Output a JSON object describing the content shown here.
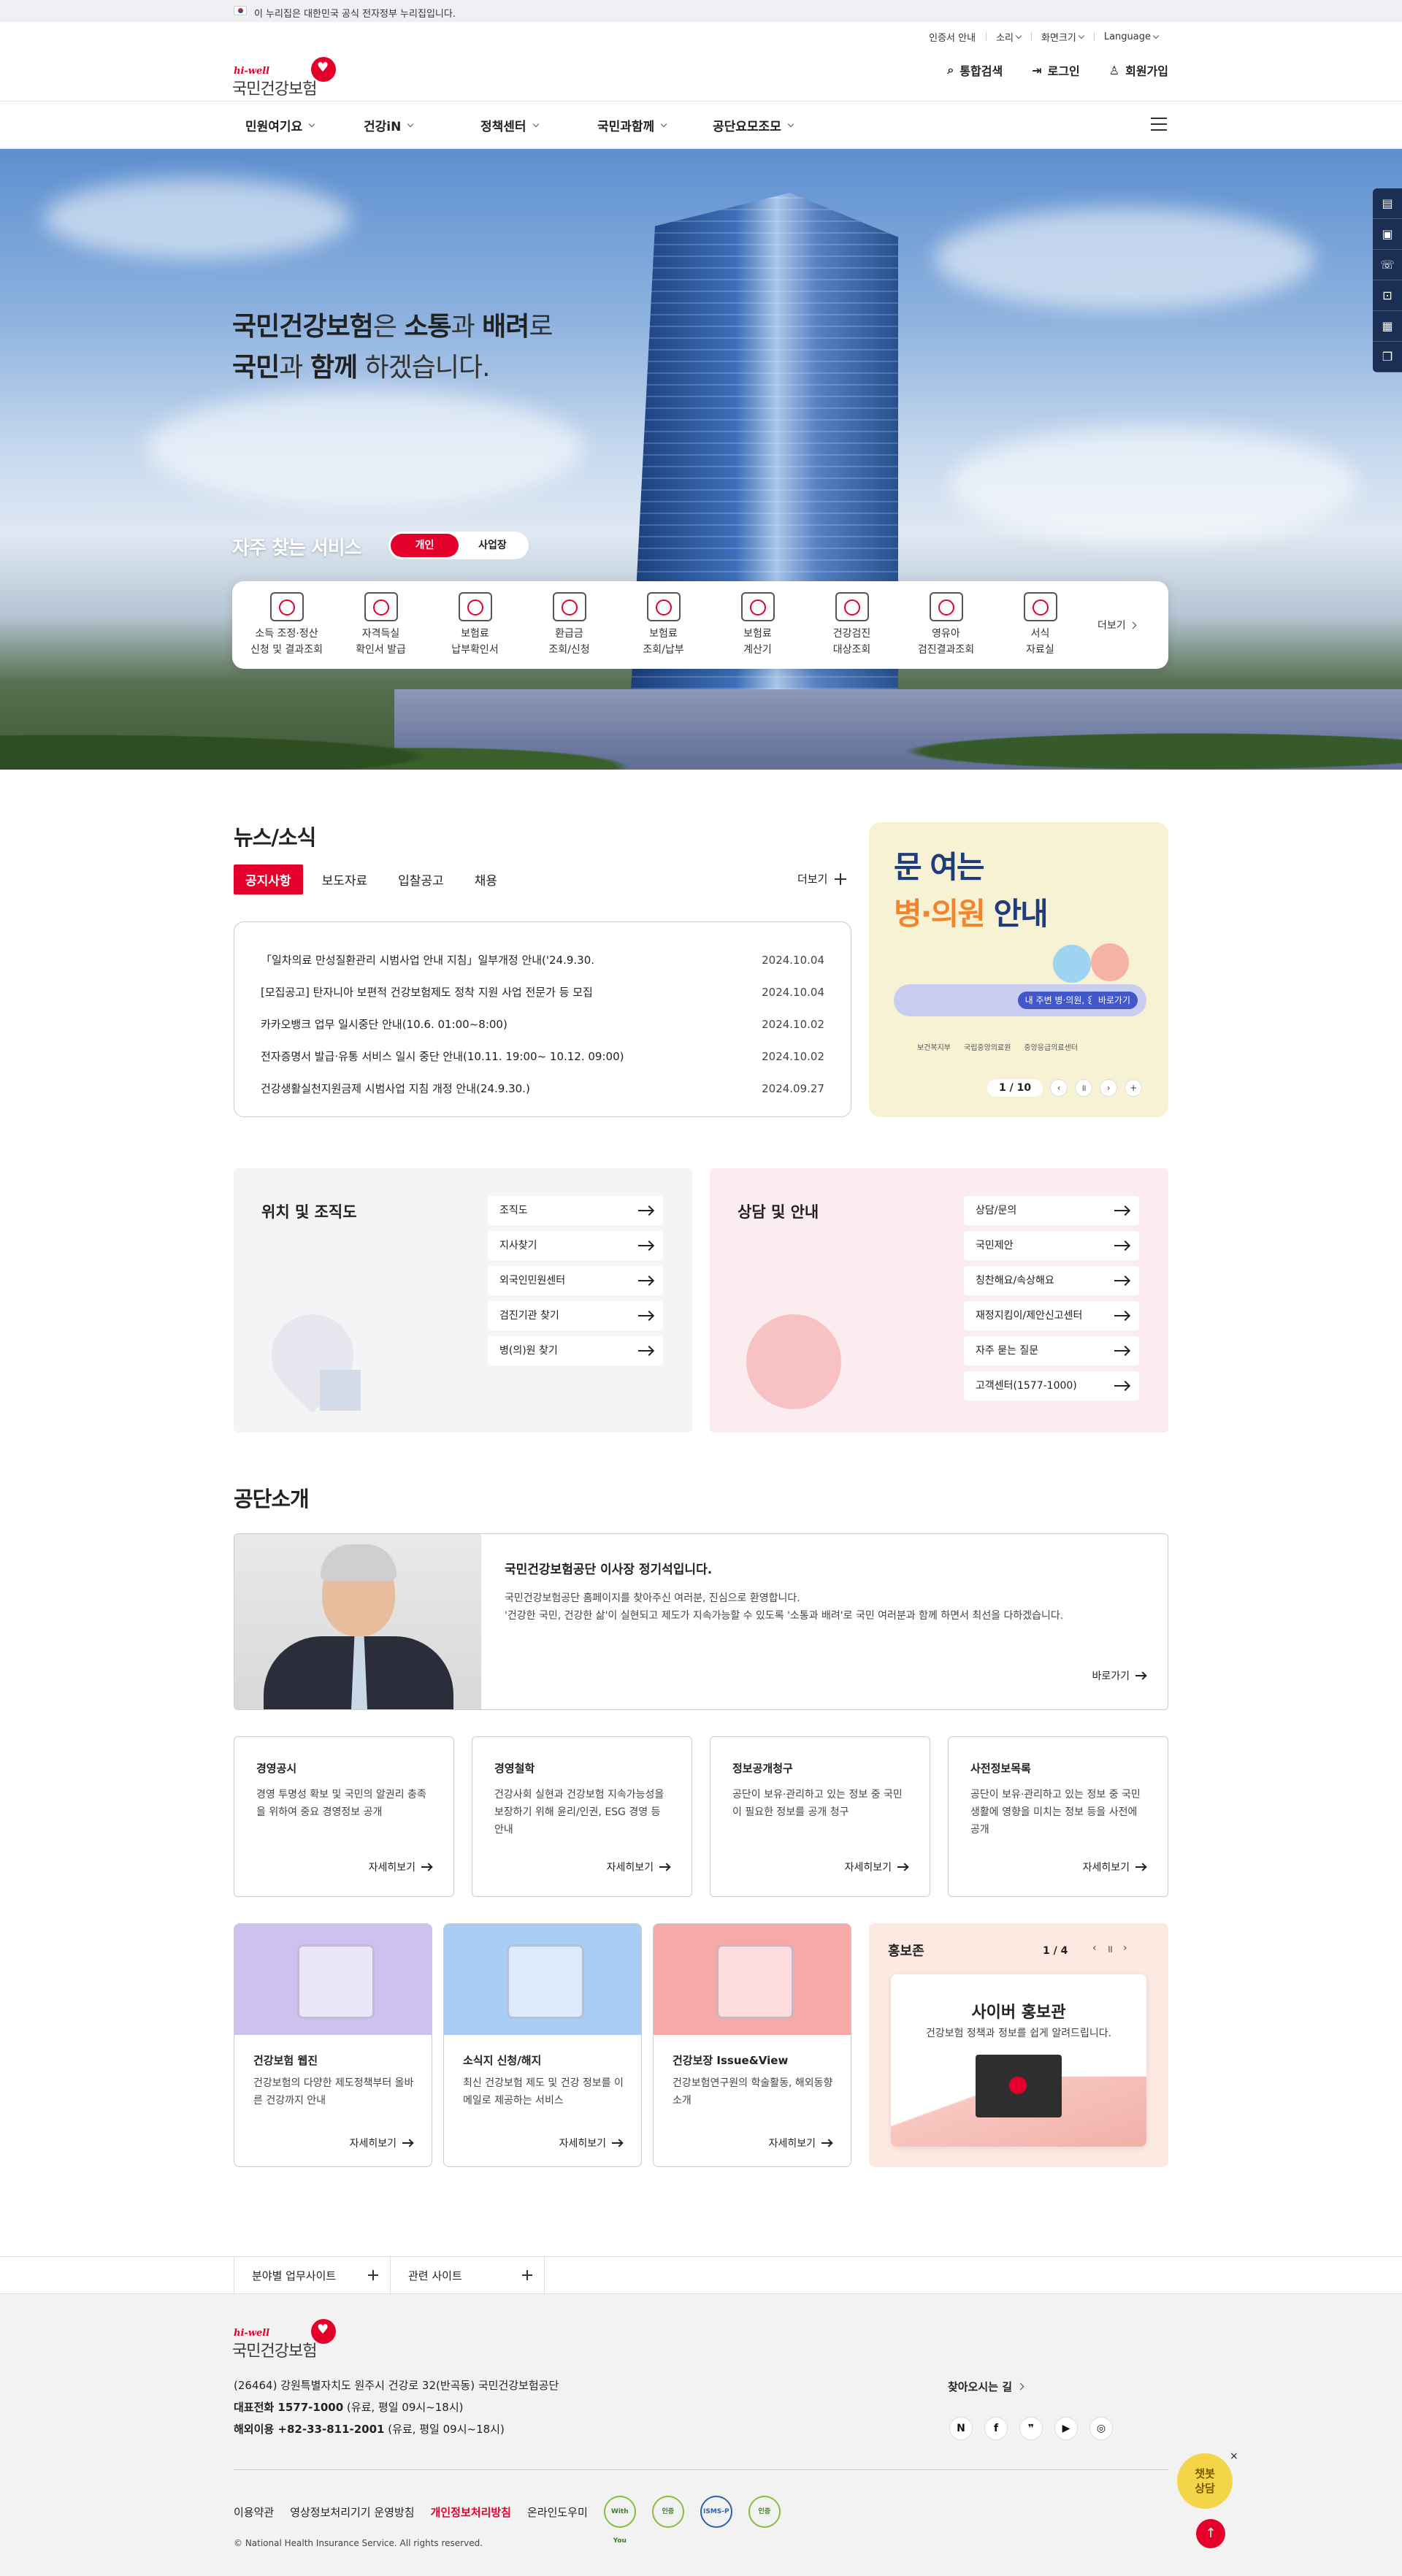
{
  "gov_banner": {
    "text": "이 누리집은 대한민국 공식 전자정부 누리집입니다."
  },
  "utility": {
    "cert": "인증서 안내",
    "sound": "소리",
    "zoom": "화면크기",
    "language": "Language"
  },
  "logo": {
    "small": "hi-well",
    "name": "국민건강보험"
  },
  "header": {
    "search": "통합검색",
    "login": "로그인",
    "signup": "회원가입"
  },
  "gnb": [
    "민원여기요",
    "건강iN",
    "정책센터",
    "국민과함께",
    "공단요모조모"
  ],
  "hero": {
    "slogan_line1": [
      "국민건강보험",
      "은 ",
      "소통",
      "과 ",
      "배려",
      "로"
    ],
    "slogan_line2": [
      "국민",
      "과 ",
      "함께",
      " 하겠습니다."
    ],
    "freq_title": "자주 찾는 서비스",
    "toggle": [
      "개인",
      "사업장"
    ],
    "services": [
      [
        "소득 조정·정산",
        "신청 및 결과조회"
      ],
      [
        "자격득실",
        "확인서 발급"
      ],
      [
        "보험료",
        "납부확인서"
      ],
      [
        "환급금",
        "조회/신청"
      ],
      [
        "보험료",
        "조회/납부"
      ],
      [
        "보험료",
        "계산기"
      ],
      [
        "건강검진",
        "대상조회"
      ],
      [
        "영유아",
        "검진결과조회"
      ],
      [
        "서식",
        "자료실"
      ]
    ],
    "more": "더보기"
  },
  "news": {
    "title": "뉴스/소식",
    "tabs": [
      "공지사항",
      "보도자료",
      "입찰공고",
      "채용"
    ],
    "more": "더보기",
    "items": [
      {
        "title": "「일차의료 만성질환관리 시범사업 안내 지침」일부개정 안내('24.9.30.",
        "date": "2024.10.04"
      },
      {
        "title": "[모집공고] 탄자니아 보편적 건강보험제도 정착 지원 사업 전문가 등 모집",
        "date": "2024.10.04"
      },
      {
        "title": "카카오뱅크 업무 일시중단 안내(10.6. 01:00~8:00)",
        "date": "2024.10.02"
      },
      {
        "title": "전자증명서 발급·유통 서비스 일시 중단 안내(10.11. 19:00~ 10.12. 09:00)",
        "date": "2024.10.02"
      },
      {
        "title": "건강생활실천지원금제 시범사업 지침 개정 안내(24.9.30.)",
        "date": "2024.09.27"
      }
    ]
  },
  "banner": {
    "line1": "문 여는",
    "line2a": "병·의원",
    "line2b": " 안내",
    "pill": "내 주변 병·의원, 응급실 찾기",
    "pill_btn": "바로가기",
    "logos": [
      "보건복지부",
      "국립중앙의료원",
      "중앙응급의료센터"
    ],
    "page": "1 / 10"
  },
  "location": {
    "title": "위치 및 조직도",
    "links": [
      "조직도",
      "지사찾기",
      "외국인민원센터",
      "검진기관 찾기",
      "병(의)원 찾기"
    ]
  },
  "consult": {
    "title": "상담 및 안내",
    "links": [
      "상담/문의",
      "국민제안",
      "칭찬해요/속상해요",
      "재정지킴이/제안신고센터",
      "자주 묻는 질문",
      "고객센터(1577-1000)"
    ]
  },
  "intro": {
    "title": "공단소개",
    "ceo_title": "국민건강보험공단 이사장 정기석입니다.",
    "ceo_text1": "국민건강보험공단 홈페이지를 찾아주신 여러분, 진심으로 환영합니다.",
    "ceo_text2": "'건강한 국민, 건강한 삶'이 실현되고 제도가 지속가능할 수 있도록 '소통과 배려'로 국민 여러분과 함께 하면서 최선을 다하겠습니다.",
    "go": "바로가기",
    "cards": [
      {
        "title": "경영공시",
        "text": "경영 투명성 확보 및 국민의 알권리 충족을 위하여 중요 경영정보 공개",
        "go": "자세히보기"
      },
      {
        "title": "경영철학",
        "text": "건강사회 실현과 건강보험 지속가능성을 보장하기 위해 윤리/인권, ESG 경영 등 안내",
        "go": "자세히보기"
      },
      {
        "title": "정보공개청구",
        "text": "공단이 보유·관리하고 있는 정보 중 국민이 필요한 정보를 공개 청구",
        "go": "자세히보기"
      },
      {
        "title": "사전정보목록",
        "text": "공단이 보유·관리하고 있는 정보 중 국민생활에 영향을 미치는 정보 등을 사전에 공개",
        "go": "자세히보기"
      }
    ],
    "pcards": [
      {
        "title": "건강보험 웹진",
        "text": "건강보험의 다양한 제도정책부터 올바른 건강까지 안내",
        "go": "자세히보기"
      },
      {
        "title": "소식지 신청/해지",
        "text": "최신 건강보험 제도 및 건강 정보를 이메일로 제공하는 서비스",
        "go": "자세히보기"
      },
      {
        "title": "건강보장 Issue&View",
        "text": "건강보험연구원의 학술활동, 해외동향 소개",
        "go": "자세히보기"
      }
    ],
    "promo": {
      "title": "홍보존",
      "page": "1 / 4",
      "inner_title": "사이버 홍보관",
      "inner_sub": "건강보험 정책과 정보를 쉽게 알려드립니다."
    }
  },
  "family": [
    "분야별 업무사이트",
    "관련 사이트"
  ],
  "footer": {
    "address": "(26464) 강원특별자치도 원주시 건강로 32(반곡동) 국민건강보험공단",
    "phone_label": "대표전화 1577-1000",
    "phone_note": " (유료, 평일 09시~18시)",
    "abroad_label": "해외이용 +82-33-811-2001",
    "abroad_note": " (유료, 평일 09시~18시)",
    "directions": "찾아오시는 길",
    "sns": [
      "N",
      "f",
      "❞",
      "▶",
      "◎"
    ],
    "links": [
      "이용약관",
      "영상정보처리기기 운영방침",
      "개인정보처리방침",
      "온라인도우미"
    ],
    "badges": [
      "With You",
      "인증",
      "ISMS-P",
      "인증"
    ],
    "copyright": "© National Health Insurance Service. All rights reserved."
  },
  "chatbot": {
    "label1": "챗봇",
    "label2": "상담"
  },
  "colors": {
    "brand": "#e4002b",
    "navy": "#1b2f55"
  }
}
